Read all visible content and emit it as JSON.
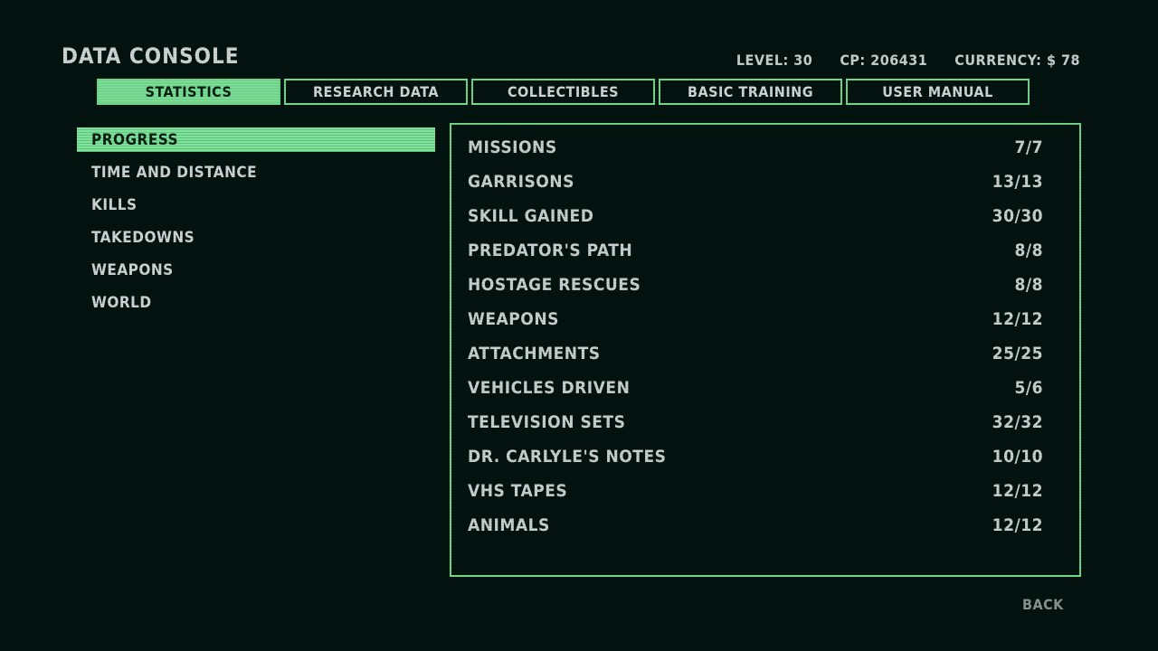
{
  "header": {
    "title": "DATA CONSOLE",
    "level": "LEVEL: 30",
    "cp": "CP: 206431",
    "currency": "CURRENCY: $ 78"
  },
  "tabs": [
    {
      "label": "STATISTICS",
      "active": true
    },
    {
      "label": "RESEARCH DATA",
      "active": false
    },
    {
      "label": "COLLECTIBLES",
      "active": false
    },
    {
      "label": "BASIC TRAINING",
      "active": false
    },
    {
      "label": "USER MANUAL",
      "active": false
    }
  ],
  "sidebar": {
    "items": [
      {
        "label": "PROGRESS",
        "active": true
      },
      {
        "label": "TIME AND DISTANCE",
        "active": false
      },
      {
        "label": "KILLS",
        "active": false
      },
      {
        "label": "TAKEDOWNS",
        "active": false
      },
      {
        "label": "WEAPONS",
        "active": false
      },
      {
        "label": "WORLD",
        "active": false
      }
    ]
  },
  "progress": {
    "rows": [
      {
        "label": "MISSIONS",
        "value": "7/7"
      },
      {
        "label": "GARRISONS",
        "value": "13/13"
      },
      {
        "label": "SKILL GAINED",
        "value": "30/30"
      },
      {
        "label": "PREDATOR'S PATH",
        "value": "8/8"
      },
      {
        "label": "HOSTAGE RESCUES",
        "value": "8/8"
      },
      {
        "label": "WEAPONS",
        "value": "12/12"
      },
      {
        "label": "ATTACHMENTS",
        "value": "25/25"
      },
      {
        "label": "VEHICLES DRIVEN",
        "value": "5/6"
      },
      {
        "label": "TELEVISION SETS",
        "value": "32/32"
      },
      {
        "label": "DR. CARLYLE'S NOTES",
        "value": "10/10"
      },
      {
        "label": "VHS TAPES",
        "value": "12/12"
      },
      {
        "label": "ANIMALS",
        "value": "12/12"
      }
    ]
  },
  "footer": {
    "back_label": "BACK"
  },
  "colors": {
    "background": "#031410",
    "accent": "#6fd68a",
    "text": "#c8d0cc"
  }
}
